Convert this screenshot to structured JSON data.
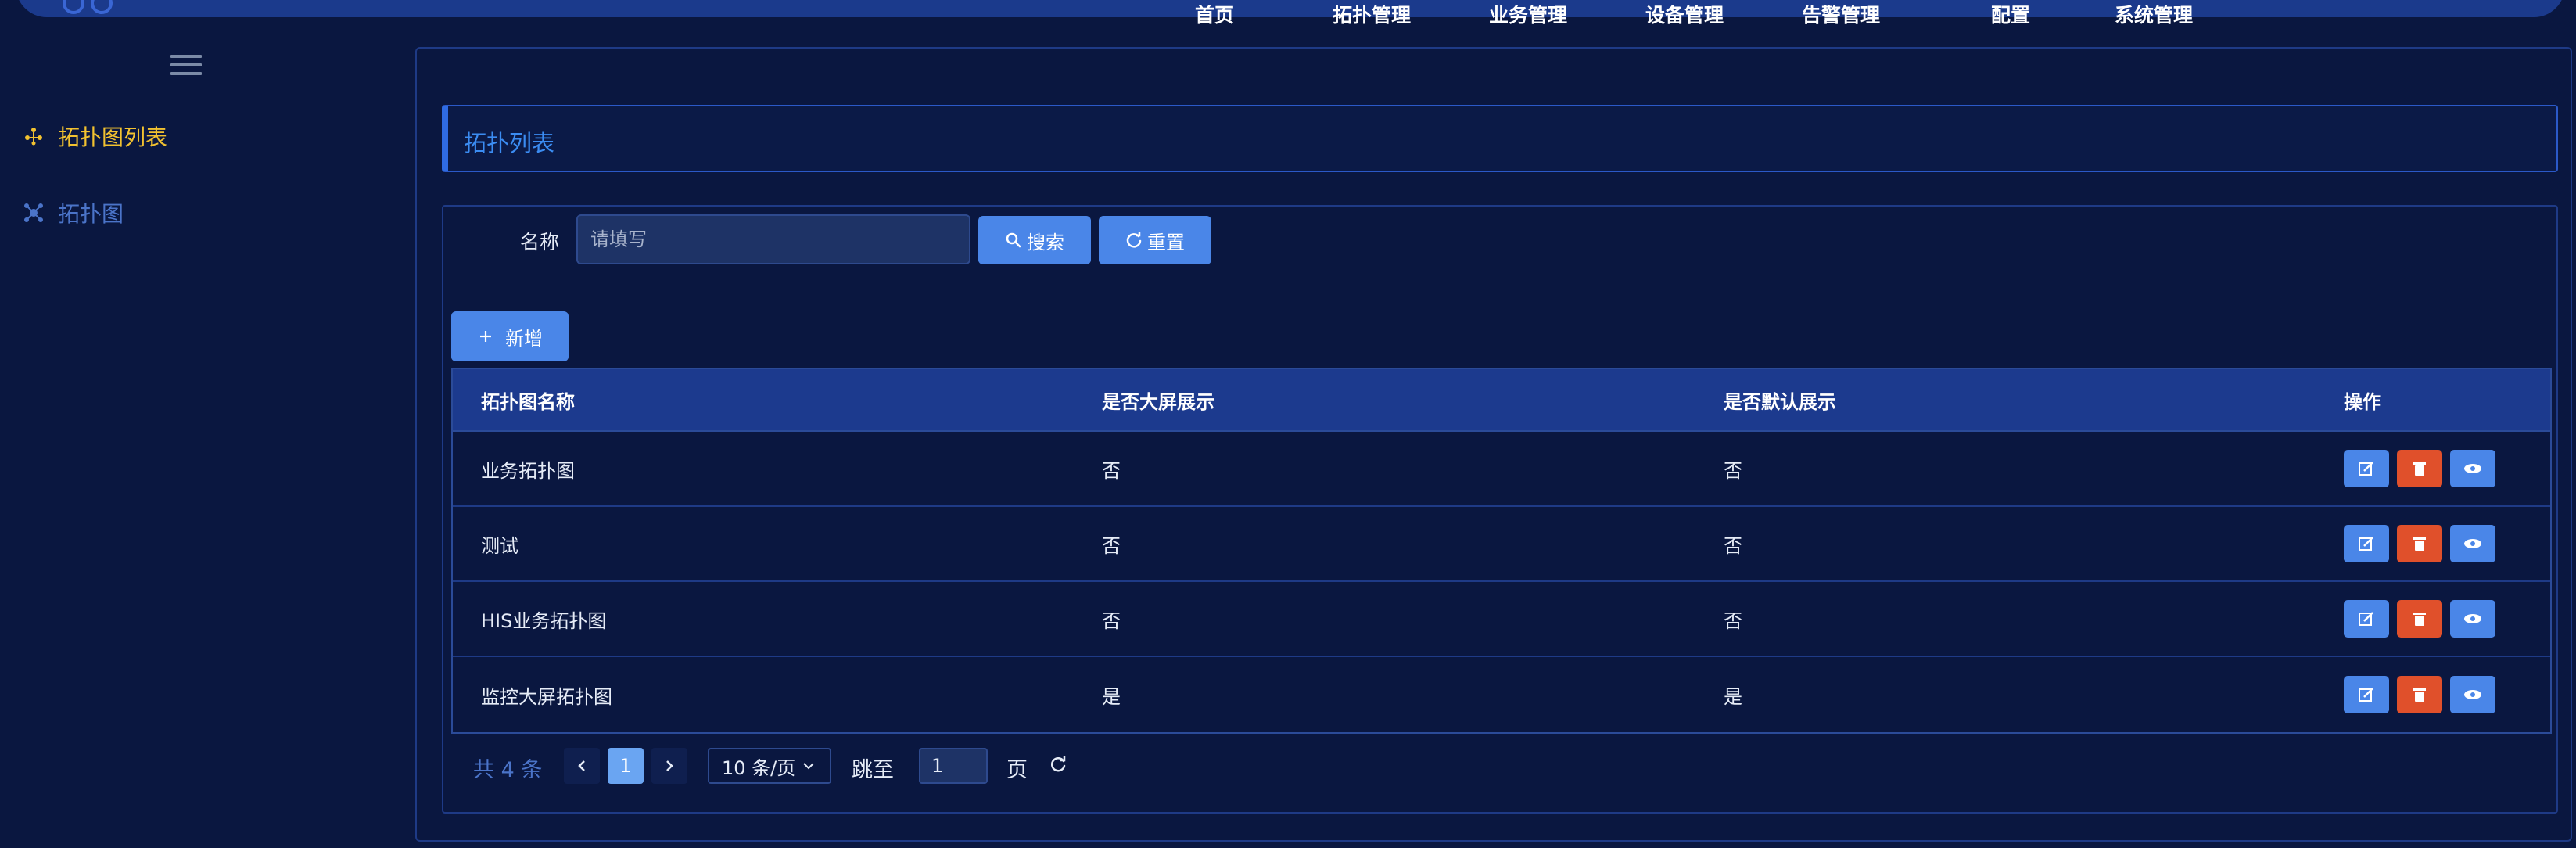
{
  "topnav": {
    "items": [
      "首页",
      "拓扑管理",
      "业务管理",
      "设备管理",
      "告警管理",
      "配置",
      "系统管理"
    ]
  },
  "sidebar": {
    "items": [
      {
        "label": "拓扑图列表",
        "icon": "topology-list-icon",
        "active": true
      },
      {
        "label": "拓扑图",
        "icon": "topology-graph-icon",
        "active": false
      }
    ]
  },
  "page": {
    "section_title": "拓扑列表"
  },
  "search": {
    "label": "名称",
    "placeholder": "请填写",
    "value": "",
    "search_button": "搜索",
    "reset_button": "重置"
  },
  "toolbar": {
    "add_button": "新增"
  },
  "table": {
    "headers": [
      "拓扑图名称",
      "是否大屏展示",
      "是否默认展示",
      "操作"
    ],
    "rows": [
      [
        "业务拓扑图",
        "否",
        "否"
      ],
      [
        "测试",
        "否",
        "否"
      ],
      [
        "HIS业务拓扑图",
        "否",
        "否"
      ],
      [
        "监控大屏拓扑图",
        "是",
        "是"
      ]
    ]
  },
  "pagination": {
    "total": "共 4 条",
    "current_page": "1",
    "page_size": "10 条/页",
    "jump_label": "跳至",
    "jump_value": "1",
    "page_label": "页"
  },
  "colors": {
    "background": "#0a1740",
    "accent": "#4a86e8",
    "danger": "#e0502b",
    "active_menu": "#f2c230"
  }
}
